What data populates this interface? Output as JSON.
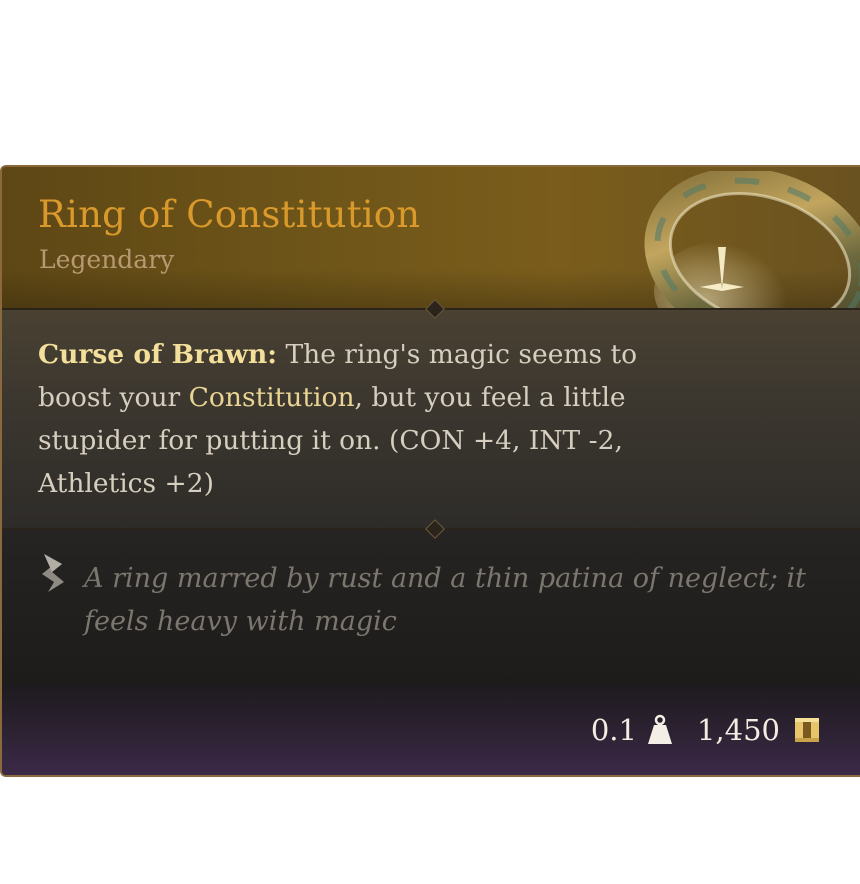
{
  "item": {
    "name": "Ring of Constitution",
    "rarity": "Legendary",
    "description": {
      "keyword": "Curse of Brawn:",
      "text_before_highlight": " The ring's magic seems to boost your ",
      "highlight": "Constitution",
      "text_after_highlight": ", but you feel a little stupider for putting it on. (CON +4, INT -2, Athletics +2)"
    },
    "lore": "A ring marred by rust and a thin patina of neglect; it feels heavy with magic",
    "weight": "0.1",
    "value": "1,450"
  },
  "icons": {
    "item_image": "ring-image",
    "lore": "scroll-quill-icon",
    "weight": "weight-icon",
    "gold": "gold-coin-icon"
  },
  "colors": {
    "title": "#d99a2b",
    "rarity": "#b79a73",
    "keyword": "#f3df9a",
    "highlight": "#ead493",
    "border": "#8a6a3c"
  }
}
